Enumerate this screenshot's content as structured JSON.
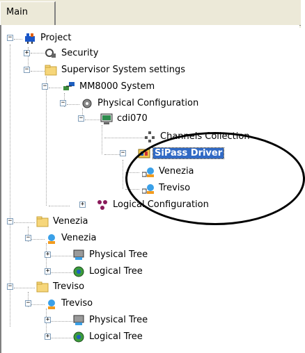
{
  "tabs": [
    {
      "label": "Main"
    }
  ],
  "tree": {
    "project": "Project",
    "security": "Security",
    "supervisor": "Supervisor System settings",
    "mm8000": "MM8000 System",
    "physical_config": "Physical Configuration",
    "cdi070": "cdi070",
    "channels": "Channels Collection",
    "sipass": "SiPass Driver",
    "sipass_venezia": "Venezia",
    "sipass_treviso": "Treviso",
    "logical_config": "Logical Configuration",
    "venezia_folder": "Venezia",
    "venezia_site": "Venezia",
    "venezia_physical": "Physical Tree",
    "venezia_logical": "Logical Tree",
    "treviso_folder": "Treviso",
    "treviso_site": "Treviso",
    "treviso_physical": "Physical Tree",
    "treviso_logical": "Logical Tree"
  },
  "expanders": {
    "expanded": "−",
    "collapsed": "+"
  },
  "colors": {
    "selection": "#316ac5",
    "folder": "#f6d67a",
    "tab_bg": "#ece9d8"
  },
  "icons": [
    "project-icon",
    "security-icon",
    "folder-icon",
    "computer-network-icon",
    "gear-icon",
    "monitor-icon",
    "channels-icon",
    "driver-icon",
    "site-icon",
    "physical-tree-icon",
    "logical-tree-icon"
  ]
}
